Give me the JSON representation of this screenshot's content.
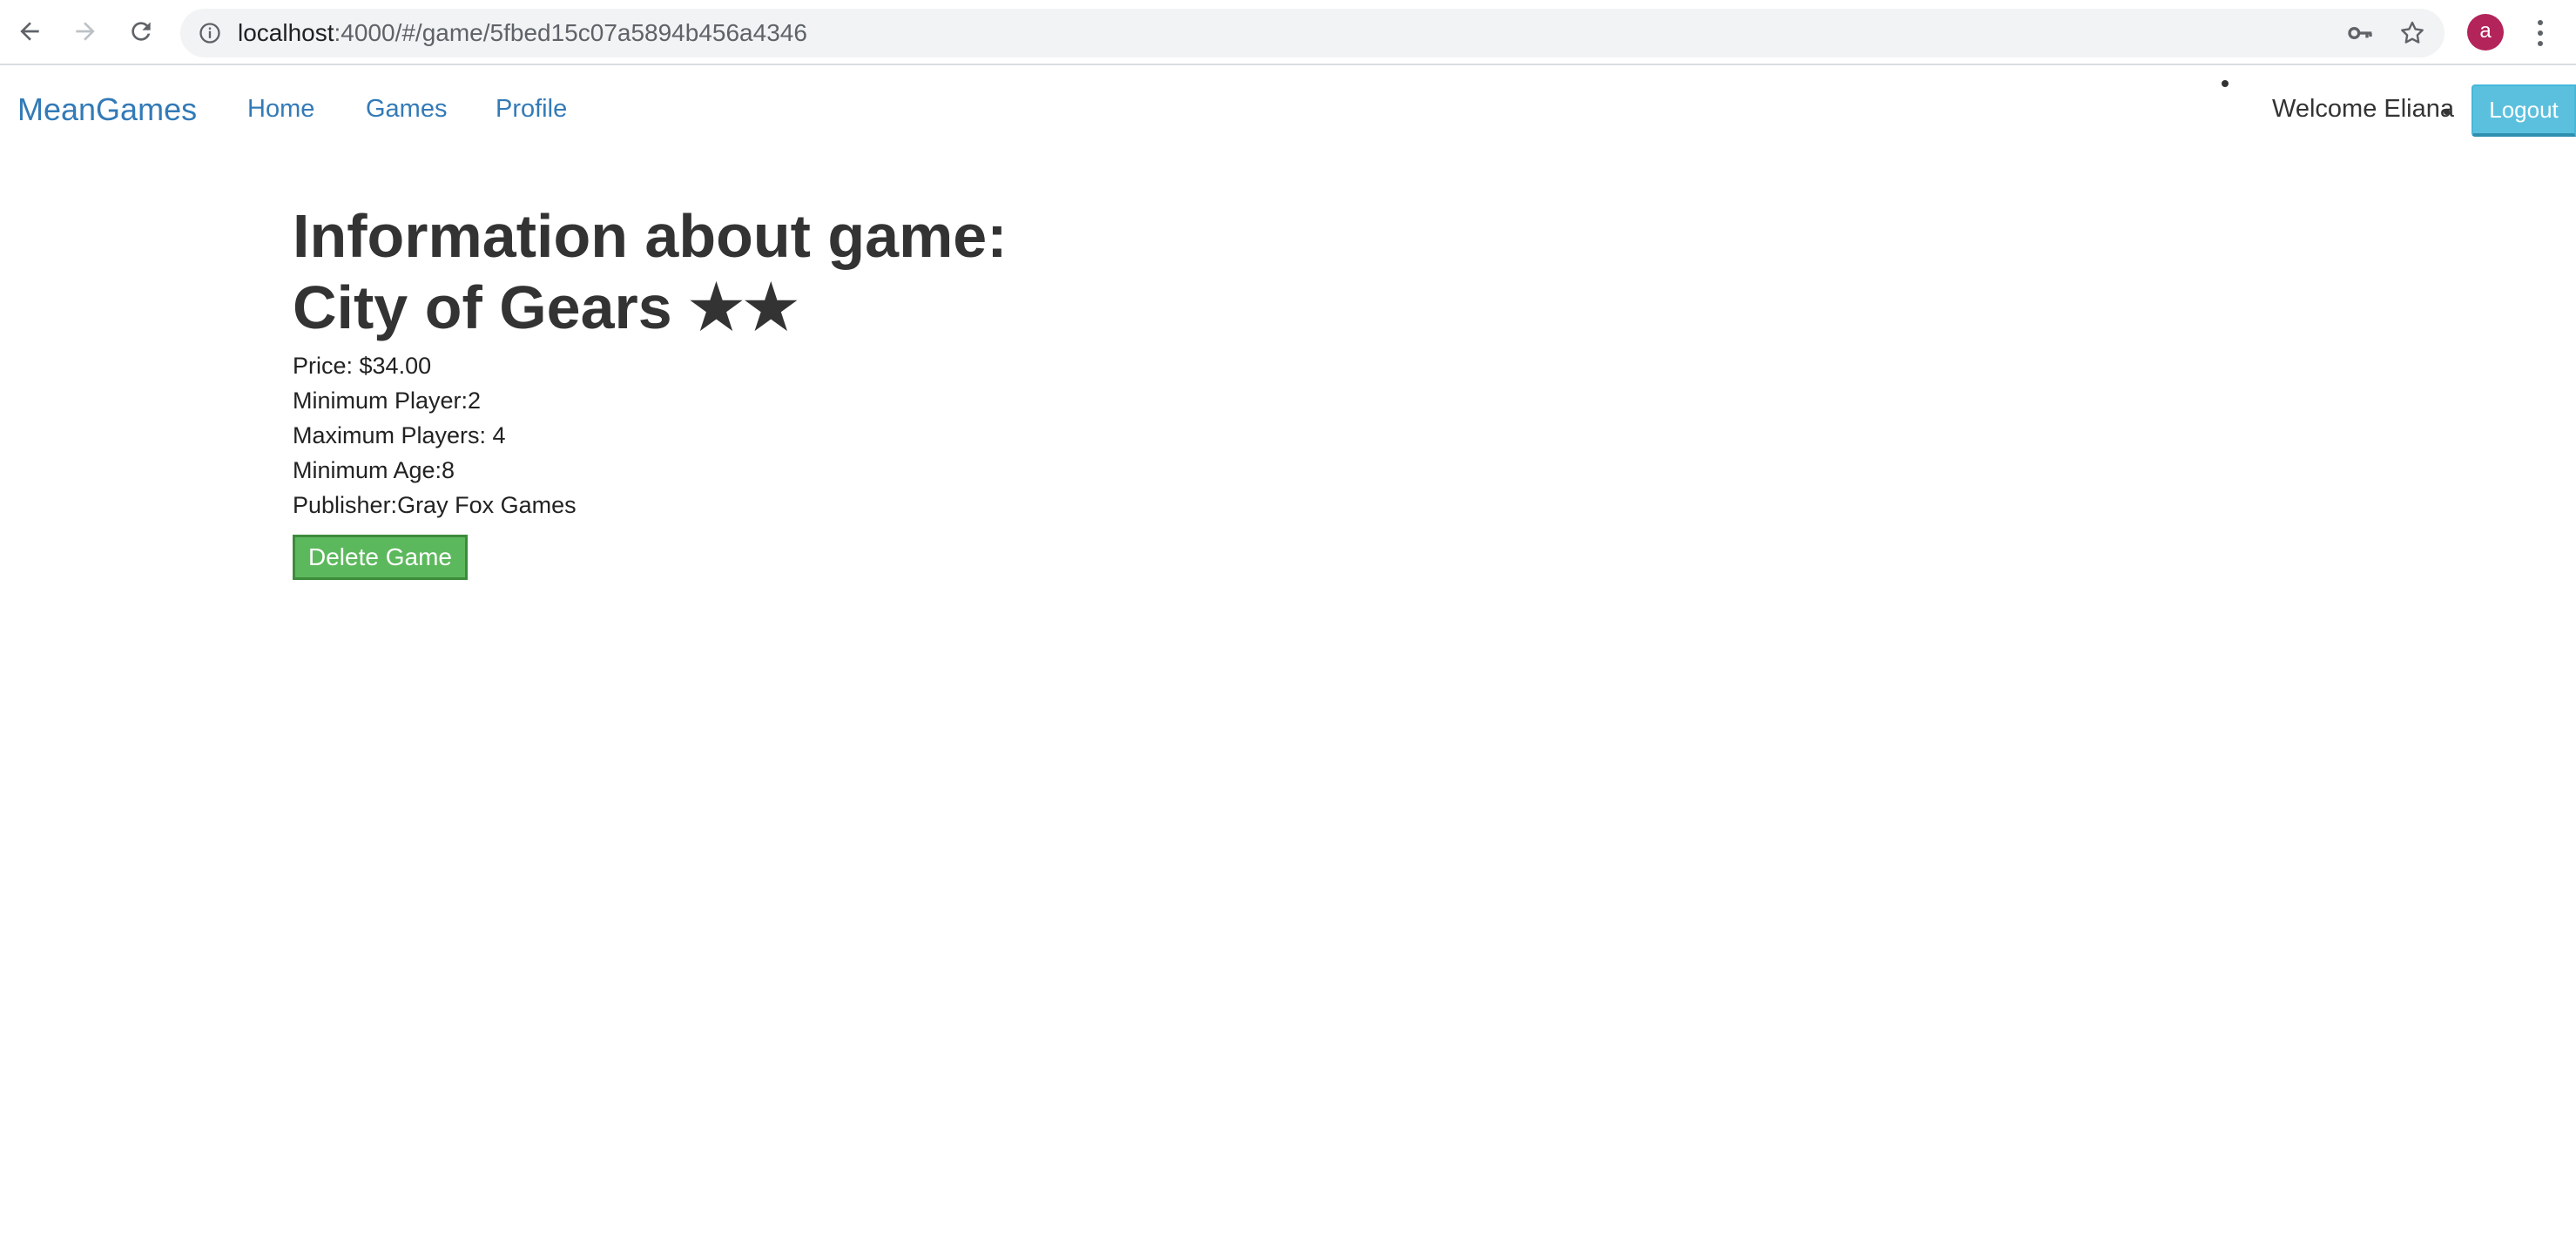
{
  "browser": {
    "url_host": "localhost",
    "url_path": ":4000/#/game/5fbed15c07a5894b456a4346",
    "profile_initial": "a",
    "icons": {
      "back": "arrow-left-icon",
      "forward": "arrow-right-icon",
      "reload": "reload-icon",
      "info": "info-icon",
      "key": "key-icon",
      "star": "star-icon",
      "menu": "kebab-menu-icon"
    },
    "colors": {
      "avatar": "#b3245a"
    }
  },
  "navbar": {
    "brand": "MeanGames",
    "links": [
      "Home",
      "Games",
      "Profile"
    ],
    "welcome": "Welcome Eliana",
    "logout_label": "Logout",
    "colors": {
      "link": "#337ab7",
      "logout": "#5bc0de"
    }
  },
  "game": {
    "heading_prefix": "Information about game:",
    "title": "City of Gears",
    "rating_stars": "★★",
    "rating": 2,
    "price": "Price: $34.00",
    "min_players": "Minimum Player:2",
    "max_players": "Maximum Players: 4",
    "min_age": "Minimum Age:8",
    "publisher": "Publisher:Gray Fox Games",
    "delete_label": "Delete Game",
    "colors": {
      "delete": "#5cb85c"
    }
  }
}
